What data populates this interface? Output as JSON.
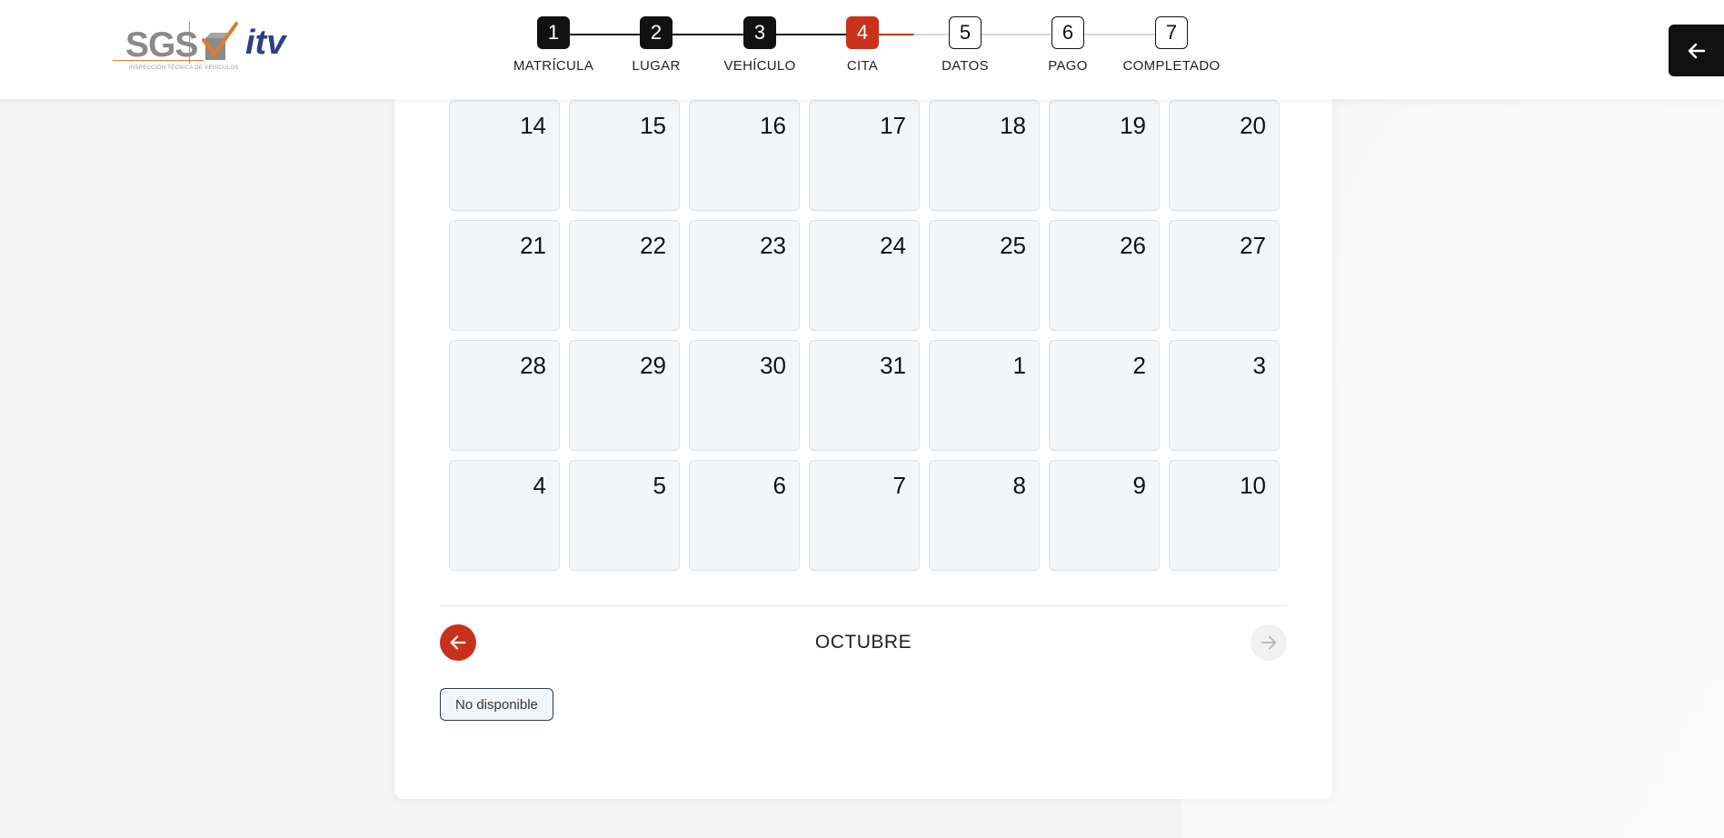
{
  "brand": {
    "logo_text": "SGS",
    "logo_subtitle": "INSPECCIÓN TÉCNICA DE VEHÍCULOS",
    "logo_itv": "itv",
    "accent": "#c8321c"
  },
  "steps": [
    {
      "number": "1",
      "label": "MATRÍCULA",
      "status": "done"
    },
    {
      "number": "2",
      "label": "LUGAR",
      "status": "done"
    },
    {
      "number": "3",
      "label": "VEHÍCULO",
      "status": "done"
    },
    {
      "number": "4",
      "label": "CITA",
      "status": "current"
    },
    {
      "number": "5",
      "label": "DATOS",
      "status": "todo"
    },
    {
      "number": "6",
      "label": "PAGO",
      "status": "todo"
    },
    {
      "number": "7",
      "label": "COMPLETADO",
      "status": "todo"
    }
  ],
  "back_button": {
    "icon": "arrow-left-icon"
  },
  "calendar": {
    "days": [
      "14",
      "15",
      "16",
      "17",
      "18",
      "19",
      "20",
      "21",
      "22",
      "23",
      "24",
      "25",
      "26",
      "27",
      "28",
      "29",
      "30",
      "31",
      "1",
      "2",
      "3",
      "4",
      "5",
      "6",
      "7",
      "8",
      "9",
      "10"
    ],
    "month_label": "OCTUBRE",
    "prev_icon": "arrow-left-icon",
    "next_icon": "arrow-right-icon"
  },
  "legend": {
    "unavailable": "No disponible"
  }
}
